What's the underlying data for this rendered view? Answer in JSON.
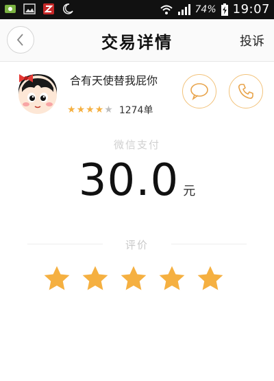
{
  "statusbar": {
    "battery_percent": "74%",
    "time": "19:07"
  },
  "header": {
    "title": "交易详情",
    "complain_label": "投诉"
  },
  "driver": {
    "name": "合有天使替我屁你",
    "rating_value": 4,
    "rating_max": 5,
    "order_count": "1274单"
  },
  "payment": {
    "label": "微信支付",
    "amount": "30.0",
    "currency": "元"
  },
  "review": {
    "label": "评价",
    "stars": 5
  },
  "colors": {
    "star": "#f5b041",
    "accent_border": "#f2c27a"
  }
}
